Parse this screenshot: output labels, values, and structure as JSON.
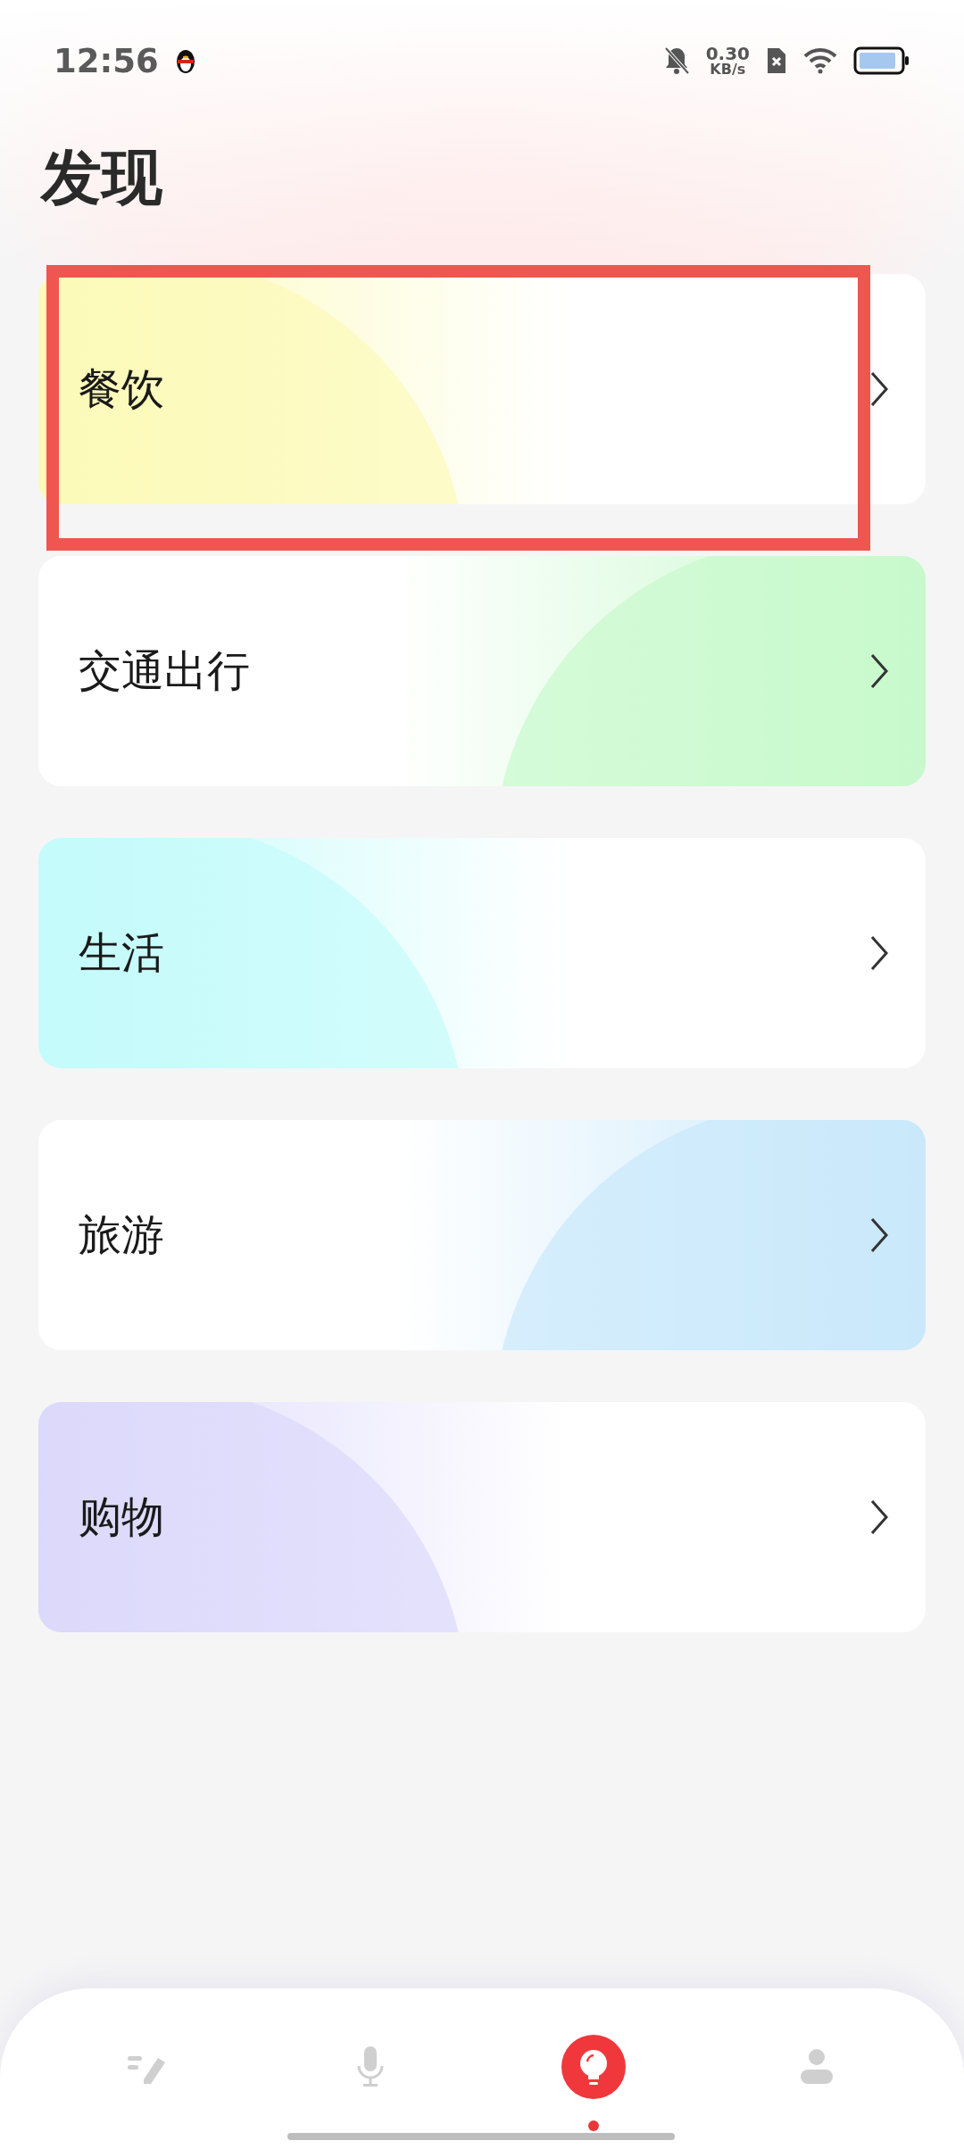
{
  "status_bar": {
    "time": "12:56",
    "net_speed": "0.30",
    "net_unit": "KB/s"
  },
  "title": "发现",
  "cards": [
    {
      "label": "餐饮",
      "color": "#fcfab8",
      "highlighted": true
    },
    {
      "label": "交通出行",
      "color": "#c8f9cc",
      "highlighted": false
    },
    {
      "label": "生活",
      "color": "#c4fbfb",
      "highlighted": false
    },
    {
      "label": "旅游",
      "color": "#c9e8fb",
      "highlighted": false
    },
    {
      "label": "购物",
      "color": "#dcd8fb",
      "highlighted": false
    }
  ],
  "nav": [
    {
      "kind": "notes",
      "selected": false
    },
    {
      "kind": "voice",
      "selected": false
    },
    {
      "kind": "discover",
      "selected": true
    },
    {
      "kind": "profile",
      "selected": false
    }
  ]
}
